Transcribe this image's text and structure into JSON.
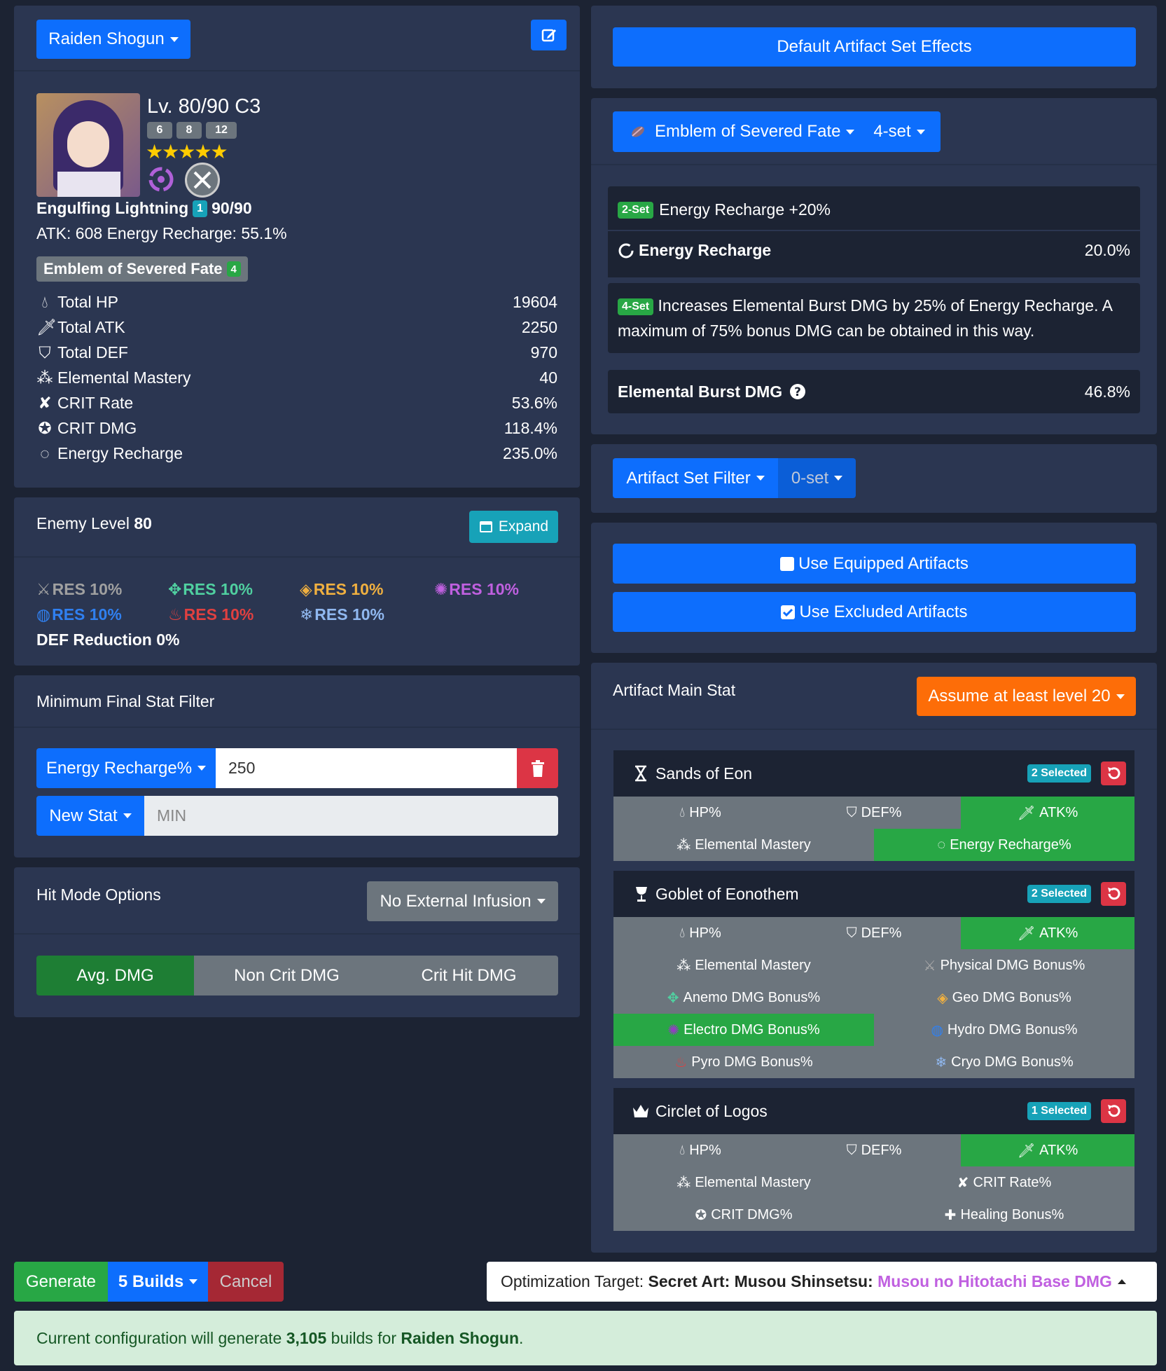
{
  "character": {
    "name_button": "Raiden Shogun",
    "level": "Lv. 80/90 C3",
    "talents": [
      "6",
      "8",
      "12"
    ],
    "stars": 5,
    "weapon_name": "Engulfing Lightning",
    "weapon_refine": "1",
    "weapon_level": "90/90",
    "weapon_stats": "ATK: 608 Energy Recharge: 55.1%",
    "set_name": "Emblem of Severed Fate",
    "set_count": "4"
  },
  "stats": [
    {
      "icon": "hp-icon",
      "label": "Total HP",
      "value": "19604"
    },
    {
      "icon": "atk-icon",
      "label": "Total ATK",
      "value": "2250"
    },
    {
      "icon": "def-icon",
      "label": "Total DEF",
      "value": "970"
    },
    {
      "icon": "em-icon",
      "label": "Elemental Mastery",
      "value": "40"
    },
    {
      "icon": "crit-rate-icon",
      "label": "CRIT Rate",
      "value": "53.6%"
    },
    {
      "icon": "crit-dmg-icon",
      "label": "CRIT DMG",
      "value": "118.4%"
    },
    {
      "icon": "energy-recharge-icon",
      "label": "Energy Recharge",
      "value": "235.0%"
    }
  ],
  "enemy": {
    "label": "Enemy Level",
    "level": "80",
    "expand": "Expand",
    "res": [
      {
        "label": "RES 10%",
        "color": "#a0a0a0",
        "icon": "physical-icon"
      },
      {
        "label": "RES 10%",
        "color": "#50d0a0",
        "icon": "anemo-icon"
      },
      {
        "label": "RES 10%",
        "color": "#f0b040",
        "icon": "geo-icon"
      },
      {
        "label": "RES 10%",
        "color": "#c060e0",
        "icon": "electro-icon"
      },
      {
        "label": "RES 10%",
        "color": "#3080f0",
        "icon": "hydro-icon"
      },
      {
        "label": "RES 10%",
        "color": "#e04040",
        "icon": "pyro-icon"
      },
      {
        "label": "RES 10%",
        "color": "#90b8f0",
        "icon": "cryo-icon"
      }
    ],
    "def_reduction": "DEF Reduction 0%"
  },
  "min_filter": {
    "title": "Minimum Final Stat Filter",
    "stat_button": "Energy Recharge%",
    "value": "250",
    "new_stat": "New Stat",
    "min_placeholder": "MIN"
  },
  "hit_mode": {
    "title": "Hit Mode Options",
    "infusion": "No External Infusion",
    "options": [
      "Avg. DMG",
      "Non Crit DMG",
      "Crit Hit DMG"
    ]
  },
  "right": {
    "default_set_effects": "Default Artifact Set Effects",
    "set_dropdown": "Emblem of Severed Fate",
    "set_count_dropdown": "4-set",
    "two_set_badge": "2-Set",
    "two_set_text": "Energy Recharge +20%",
    "two_set_stat": "Energy Recharge",
    "two_set_value": "20.0%",
    "four_set_badge": "4-Set",
    "four_set_text": "Increases Elemental Burst DMG by 25% of Energy Recharge. A maximum of 75% bonus DMG can be obtained in this way.",
    "burst_label": "Elemental Burst DMG",
    "burst_value": "46.8%",
    "filter_button": "Artifact Set Filter",
    "filter_count": "0-set",
    "use_equipped": "Use Equipped Artifacts",
    "use_excluded": "Use Excluded Artifacts",
    "main_stat_title": "Artifact Main Stat",
    "assume_level": "Assume at least level 20"
  },
  "slots": {
    "sands": {
      "name": "Sands of Eon",
      "selected": "2 Selected",
      "options": [
        "HP%",
        "DEF%",
        "ATK%",
        "Elemental Mastery",
        "Energy Recharge%"
      ]
    },
    "goblet": {
      "name": "Goblet of Eonothem",
      "selected": "2 Selected",
      "options": [
        "HP%",
        "DEF%",
        "ATK%",
        "Elemental Mastery",
        "Physical DMG Bonus%",
        "Anemo DMG Bonus%",
        "Geo DMG Bonus%",
        "Electro DMG Bonus%",
        "Hydro DMG Bonus%",
        "Pyro DMG Bonus%",
        "Cryo DMG Bonus%"
      ]
    },
    "circlet": {
      "name": "Circlet of Logos",
      "selected": "1 Selected",
      "options": [
        "HP%",
        "DEF%",
        "ATK%",
        "Elemental Mastery",
        "CRIT Rate%",
        "CRIT DMG%",
        "Healing Bonus%"
      ]
    }
  },
  "footer": {
    "generate": "Generate",
    "builds": "5 Builds",
    "cancel": "Cancel",
    "target_prefix": "Optimization Target:",
    "target_main": "Secret Art: Musou Shinsetsu:",
    "target_sub": "Musou no Hitotachi Base DMG",
    "alert_prefix": "Current configuration will generate",
    "alert_count": "3,105",
    "alert_mid": "builds for",
    "alert_name": "Raiden Shogun",
    "alert_end": "."
  },
  "colors": {
    "primary": "#0d6efd",
    "success": "#28a745",
    "danger": "#dc3545",
    "info": "#17a2b8",
    "warning": "#fd7e14",
    "electro": "#c060e0"
  }
}
